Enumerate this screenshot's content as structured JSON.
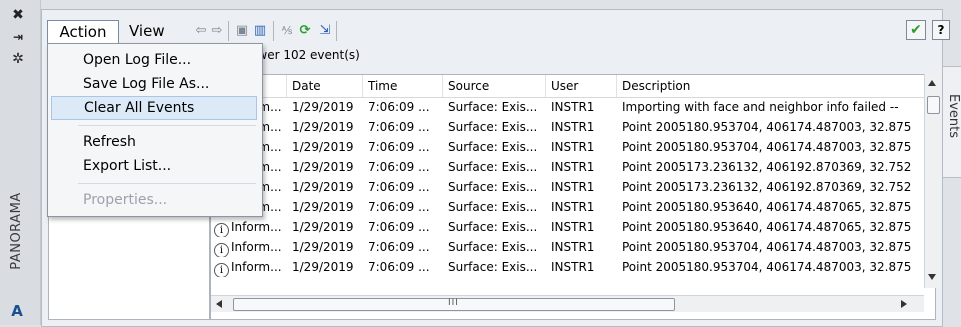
{
  "left_strip": {
    "close_glyph": "✖",
    "pin_glyph": "⇥",
    "settings_glyph": "✲",
    "palette_title": "PANORAMA",
    "app_icon_glyph": "A"
  },
  "right_tab": {
    "label": "Events"
  },
  "toolbar": {
    "action_label": "Action",
    "view_label": "View"
  },
  "status": {
    "viewer_text": "ewer   102 event(s)"
  },
  "menu": {
    "items": [
      {
        "label": "Open Log File...",
        "enabled": true
      },
      {
        "label": "Save Log File As...",
        "enabled": true
      },
      {
        "label": "Clear All Events",
        "enabled": true,
        "highlighted": true
      },
      {
        "label": "Refresh",
        "enabled": true
      },
      {
        "label": "Export List...",
        "enabled": true
      },
      {
        "label": "Properties...",
        "enabled": false
      }
    ]
  },
  "grid": {
    "columns": [
      "",
      "Date",
      "Time",
      "Source",
      "User",
      "Description"
    ],
    "rows": [
      {
        "type": "Inform...",
        "date": "1/29/2019",
        "time": "7:06:09 ...",
        "source": "Surface: Exis...",
        "user": "INSTR1",
        "desc": "Importing with face and neighbor info failed --"
      },
      {
        "type": "Inform...",
        "date": "1/29/2019",
        "time": "7:06:09 ...",
        "source": "Surface: Exis...",
        "user": "INSTR1",
        "desc": "Point 2005180.953704, 406174.487003, 32.875"
      },
      {
        "type": "Inform...",
        "date": "1/29/2019",
        "time": "7:06:09 ...",
        "source": "Surface: Exis...",
        "user": "INSTR1",
        "desc": "Point 2005180.953704, 406174.487003, 32.875"
      },
      {
        "type": "Inform...",
        "date": "1/29/2019",
        "time": "7:06:09 ...",
        "source": "Surface: Exis...",
        "user": "INSTR1",
        "desc": "Point 2005173.236132, 406192.870369, 32.752"
      },
      {
        "type": "Inform...",
        "date": "1/29/2019",
        "time": "7:06:09 ...",
        "source": "Surface: Exis...",
        "user": "INSTR1",
        "desc": "Point 2005173.236132, 406192.870369, 32.752"
      },
      {
        "type": "Inform...",
        "date": "1/29/2019",
        "time": "7:06:09 ...",
        "source": "Surface: Exis...",
        "user": "INSTR1",
        "desc": "Point 2005180.953640, 406174.487065, 32.875"
      },
      {
        "type": "Inform...",
        "date": "1/29/2019",
        "time": "7:06:09 ...",
        "source": "Surface: Exis...",
        "user": "INSTR1",
        "desc": "Point 2005180.953640, 406174.487065, 32.875"
      },
      {
        "type": "Inform...",
        "date": "1/29/2019",
        "time": "7:06:09 ...",
        "source": "Surface: Exis...",
        "user": "INSTR1",
        "desc": "Point 2005180.953704, 406174.487003, 32.875"
      },
      {
        "type": "Inform...",
        "date": "1/29/2019",
        "time": "7:06:09 ...",
        "source": "Surface: Exis...",
        "user": "INSTR1",
        "desc": "Point 2005180.953704, 406174.487003, 32.875"
      }
    ],
    "hscroll_grip": "III"
  },
  "buttons": {
    "check_glyph": "✔",
    "help_glyph": "?"
  },
  "colors": {
    "accent": "#2e9b2e",
    "highlight": "#dce9f7"
  }
}
